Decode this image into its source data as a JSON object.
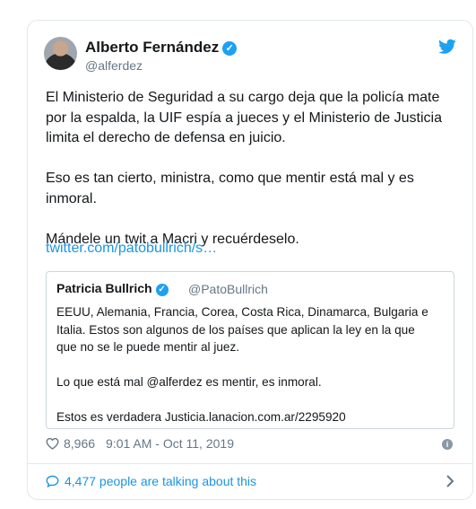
{
  "tweet": {
    "author_name": "Alberto Fernández",
    "handle": "@alferdez",
    "text": "El Ministerio de Seguridad a su cargo deja que la policía mate\npor la espalda, la UIF espía a jueces y el Ministerio de Justicia\nlimita el derecho de defensa en juicio.\n\nEso es tan cierto, ministra, como que mentir está mal y es\ninmoral.\n\nMándele un twit a Macri y recuérdeselo.",
    "link": "twitter.com/patobullrich/s…",
    "likes": "8,966",
    "timestamp": "9:01 AM - Oct 11, 2019",
    "talking": "4,477 people are talking about this"
  },
  "quoted": {
    "author_name": "Patricia Bullrich",
    "handle": "@PatoBullrich",
    "text": "EEUU, Alemania, Francia, Corea, Costa Rica, Dinamarca, Bulgaria e\nItalia. Estos son algunos de los países que aplican la ley en la que\nque no se le puede  mentir al juez.\n\nLo que está mal @alferdez es mentir, es inmoral.\n\nEstos es verdadera Justicia.lanacion.com.ar/2295920"
  },
  "icons": [
    "avatar",
    "verified-icon",
    "twitter-bird-icon",
    "heart-icon",
    "info-icon",
    "comment-bubble-icon",
    "chevron-right-icon"
  ],
  "colors": {
    "accent": "#1da1f2",
    "link": "#1b95e0",
    "muted": "#657786"
  }
}
